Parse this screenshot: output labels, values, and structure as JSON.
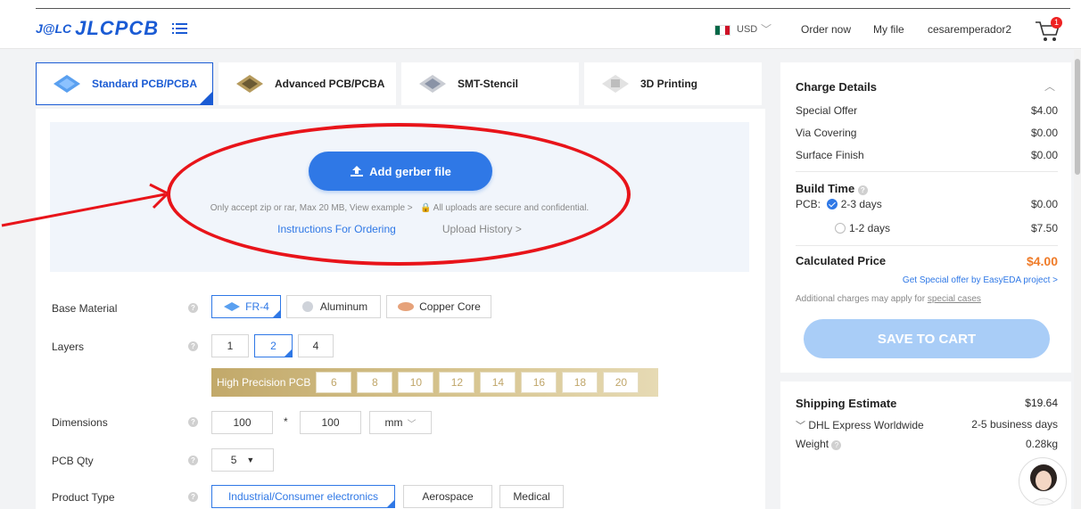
{
  "header": {
    "logo_badge": "J@LC",
    "logo_text": "JLCPCB",
    "currency": "USD",
    "nav": {
      "order_now": "Order now",
      "my_file": "My file",
      "username": "cesaremperador2"
    },
    "cart_count": "1"
  },
  "tabs": [
    {
      "label": "Standard PCB/PCBA",
      "icon": "pcb-board-icon",
      "active": true
    },
    {
      "label": "Advanced PCB/PCBA",
      "icon": "advanced-pcb-icon"
    },
    {
      "label": "SMT-Stencil",
      "icon": "stencil-icon"
    },
    {
      "label": "3D Printing",
      "icon": "3d-printing-icon"
    }
  ],
  "upload": {
    "button_label": "Add gerber file",
    "note": "Only accept zip or rar, Max 20 MB, View example >",
    "secure_note": "All uploads are secure and confidential.",
    "instructions_link": "Instructions For Ordering",
    "history_link": "Upload History >"
  },
  "form": {
    "base_material": {
      "label": "Base Material",
      "options": [
        "FR-4",
        "Aluminum",
        "Copper Core"
      ],
      "selected": "FR-4"
    },
    "layers": {
      "label": "Layers",
      "options": [
        "1",
        "2",
        "4"
      ],
      "selected": "2"
    },
    "high_precision": {
      "label": "High Precision PCB",
      "options": [
        "6",
        "8",
        "10",
        "12",
        "14",
        "16",
        "18",
        "20"
      ]
    },
    "dimensions": {
      "label": "Dimensions",
      "width": "100",
      "separator": "*",
      "height": "100",
      "unit": "mm"
    },
    "pcb_qty": {
      "label": "PCB Qty",
      "value": "5"
    },
    "product_type": {
      "label": "Product Type",
      "options": [
        "Industrial/Consumer electronics",
        "Aerospace",
        "Medical"
      ],
      "selected": "Industrial/Consumer electronics"
    }
  },
  "charge": {
    "title": "Charge Details",
    "rows": [
      {
        "label": "Special Offer",
        "value": "$4.00"
      },
      {
        "label": "Via Covering",
        "value": "$0.00"
      },
      {
        "label": "Surface Finish",
        "value": "$0.00"
      }
    ],
    "build_time": {
      "title": "Build Time",
      "pcb_label": "PCB:",
      "options": [
        {
          "label": "2-3 days",
          "value": "$0.00",
          "selected": true
        },
        {
          "label": "1-2 days",
          "value": "$7.50",
          "selected": false
        }
      ]
    },
    "calculated_label": "Calculated Price",
    "calculated_value": "$4.00",
    "easyeda_link": "Get Special offer by EasyEDA project >",
    "additional_prefix": "Additional charges may apply for ",
    "additional_link": "special cases",
    "save_button": "SAVE TO CART"
  },
  "shipping": {
    "title": "Shipping Estimate",
    "price": "$19.64",
    "carrier": "DHL Express Worldwide",
    "duration": "2-5 business days",
    "weight_label": "Weight",
    "weight_value": "0.28kg"
  },
  "colors": {
    "brand": "#1a5bd4",
    "accent": "#2f78e6",
    "price": "#ef7b28",
    "annotation": "#e8141a"
  }
}
